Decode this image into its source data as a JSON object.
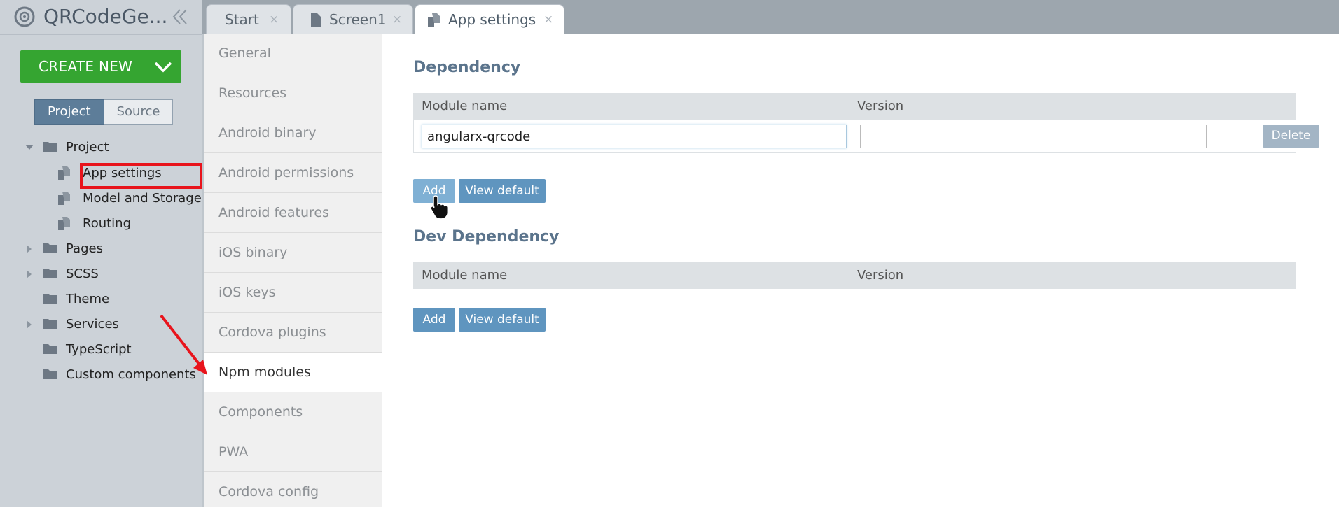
{
  "app": {
    "title": "QRCodeGe...",
    "icons": {
      "logo": "app-logo-icon",
      "collapse": "double-chevron-left-icon"
    }
  },
  "sidebar": {
    "create_new_label": "CREATE NEW",
    "create_new_color": "#35a531",
    "toggle": {
      "project": "Project",
      "source": "Source",
      "selected": "Project"
    },
    "tree": [
      {
        "label": "Project",
        "type": "folder",
        "expanded": true,
        "depth": 0
      },
      {
        "label": "App settings",
        "type": "document",
        "depth": 1,
        "highlighted": true
      },
      {
        "label": "Model and Storage",
        "type": "document",
        "depth": 1
      },
      {
        "label": "Routing",
        "type": "document",
        "depth": 1
      },
      {
        "label": "Pages",
        "type": "folder",
        "expanded": false,
        "depth": 0
      },
      {
        "label": "SCSS",
        "type": "folder",
        "expanded": false,
        "depth": 0
      },
      {
        "label": "Theme",
        "type": "folder",
        "depth": 0
      },
      {
        "label": "Services",
        "type": "folder",
        "expanded": false,
        "depth": 0
      },
      {
        "label": "TypeScript",
        "type": "folder",
        "depth": 0
      },
      {
        "label": "Custom components",
        "type": "folder",
        "depth": 0
      }
    ]
  },
  "tabs": [
    {
      "label": "Start",
      "close": "×"
    },
    {
      "label": "Screen1",
      "close": "×",
      "icon": "document-icon"
    },
    {
      "label": "App settings",
      "close": "×",
      "icon": "settings-document-icon",
      "active": true
    }
  ],
  "settings_menu": {
    "items": [
      "General",
      "Resources",
      "Android binary",
      "Android permissions",
      "Android features",
      "iOS binary",
      "iOS keys",
      "Cordova plugins",
      "Npm modules",
      "Components",
      "PWA",
      "Cordova config"
    ],
    "active": "Npm modules"
  },
  "dependency": {
    "title": "Dependency",
    "col_module": "Module name",
    "col_version": "Version",
    "row": {
      "module": "angularx-qrcode",
      "version": "",
      "delete_label": "Delete"
    },
    "add_label": "Add",
    "view_default_label": "View default"
  },
  "dev_dependency": {
    "title": "Dev Dependency",
    "col_module": "Module name",
    "col_version": "Version",
    "add_label": "Add",
    "view_default_label": "View default"
  },
  "annotations": {
    "highlight_color": "#e8141c",
    "arrow_color": "#e8141c"
  }
}
